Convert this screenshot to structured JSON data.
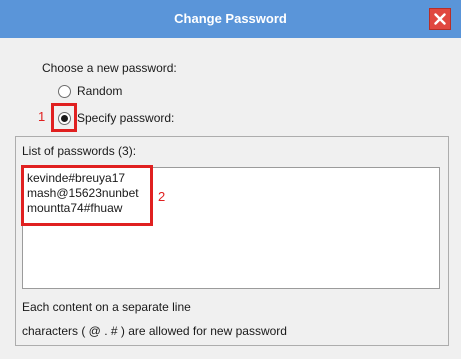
{
  "window": {
    "title": "Change Password",
    "close_icon": "close-icon"
  },
  "prompt": "Choose a new password:",
  "options": [
    {
      "label": "Random",
      "selected": false
    },
    {
      "label": "Specify password:",
      "selected": true
    }
  ],
  "password_list": {
    "label": "List of passwords (3):",
    "entries": [
      "kevinde#breuya17",
      "mash@15623nunbet",
      "mountta74#fhuaw"
    ]
  },
  "hints": [
    "Each content on a separate line",
    "characters ( @ . # ) are allowed for new password"
  ],
  "annotations": [
    "1",
    "2"
  ],
  "colors": {
    "titlebar": "#5a95d9",
    "close_button": "#e0473f",
    "annotation": "#e02020"
  }
}
